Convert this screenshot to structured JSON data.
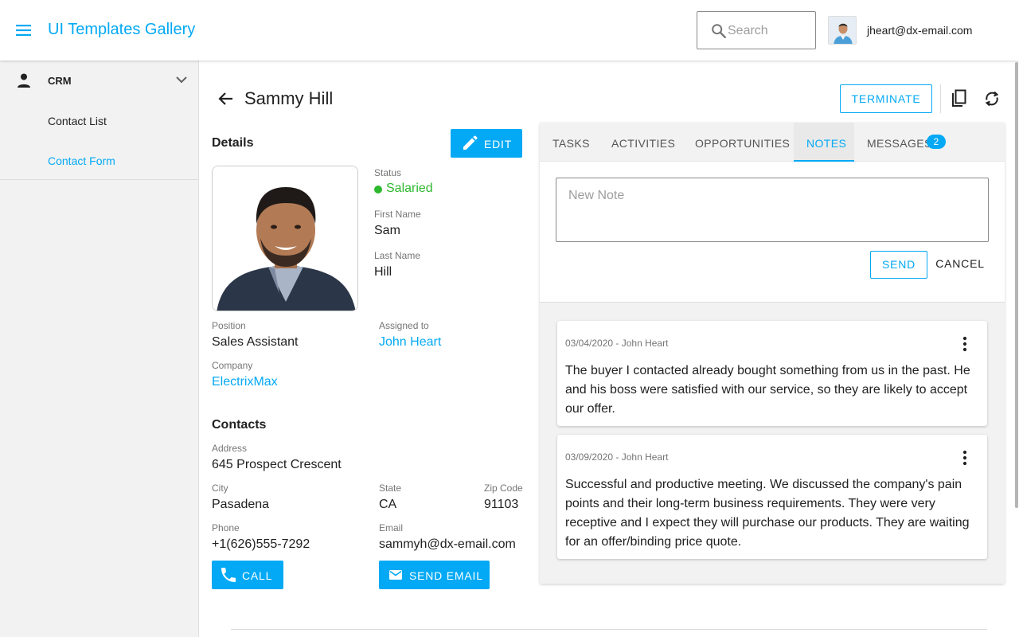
{
  "app": {
    "title": "UI Templates Gallery",
    "search_placeholder": "Search",
    "user_email": "jheart@dx-email.com"
  },
  "sidebar": {
    "group_label": "CRM",
    "items": [
      {
        "label": "Contact List",
        "active": false
      },
      {
        "label": "Contact Form",
        "active": true
      }
    ]
  },
  "contact": {
    "name": "Sammy Hill",
    "terminate_label": "TERMINATE",
    "details_title": "Details",
    "edit_label": "EDIT",
    "status_label": "Status",
    "status_value": "Salaried",
    "status_color": "#2eb82e",
    "first_name_label": "First Name",
    "first_name": "Sam",
    "last_name_label": "Last Name",
    "last_name": "Hill",
    "position_label": "Position",
    "position": "Sales Assistant",
    "assigned_label": "Assigned to",
    "assigned_to": "John Heart",
    "company_label": "Company",
    "company": "ElectrixMax",
    "contacts_title": "Contacts",
    "address_label": "Address",
    "address": "645 Prospect Crescent",
    "city_label": "City",
    "city": "Pasadena",
    "state_label": "State",
    "state": "CA",
    "zip_label": "Zip Code",
    "zip": "91103",
    "phone_label": "Phone",
    "phone": "+1(626)555-7292",
    "email_label": "Email",
    "email": "sammyh@dx-email.com",
    "call_label": "CALL",
    "send_email_label": "SEND EMAIL"
  },
  "tabs": [
    {
      "label": "TASKS",
      "active": false
    },
    {
      "label": "ACTIVITIES",
      "active": false
    },
    {
      "label": "OPPORTUNITIES",
      "active": false
    },
    {
      "label": "NOTES",
      "active": true
    },
    {
      "label": "MESSAGES",
      "active": false,
      "badge": "2"
    }
  ],
  "notes": {
    "input_placeholder": "New Note",
    "send_label": "SEND",
    "cancel_label": "CANCEL",
    "items": [
      {
        "meta": "03/04/2020 - John Heart",
        "text": "The buyer I contacted already bought something from us in the past. He and his boss were satisfied with our service, so they are likely to accept our offer."
      },
      {
        "meta": "03/09/2020 - John Heart",
        "text": "Successful and productive meeting. We discussed the company's pain points and their long-term business requirements. They were very receptive and I expect they will purchase our products. They are waiting for an offer/binding price quote."
      }
    ]
  },
  "colors": {
    "accent": "#03a9f4",
    "status_green": "#2eb82e"
  },
  "icons": [
    "menu-icon",
    "search-icon",
    "person-icon",
    "chevron-down-icon",
    "arrow-back-icon",
    "copy-icon",
    "refresh-icon",
    "edit-pencil-icon",
    "phone-icon",
    "mail-icon",
    "more-vert-icon"
  ]
}
